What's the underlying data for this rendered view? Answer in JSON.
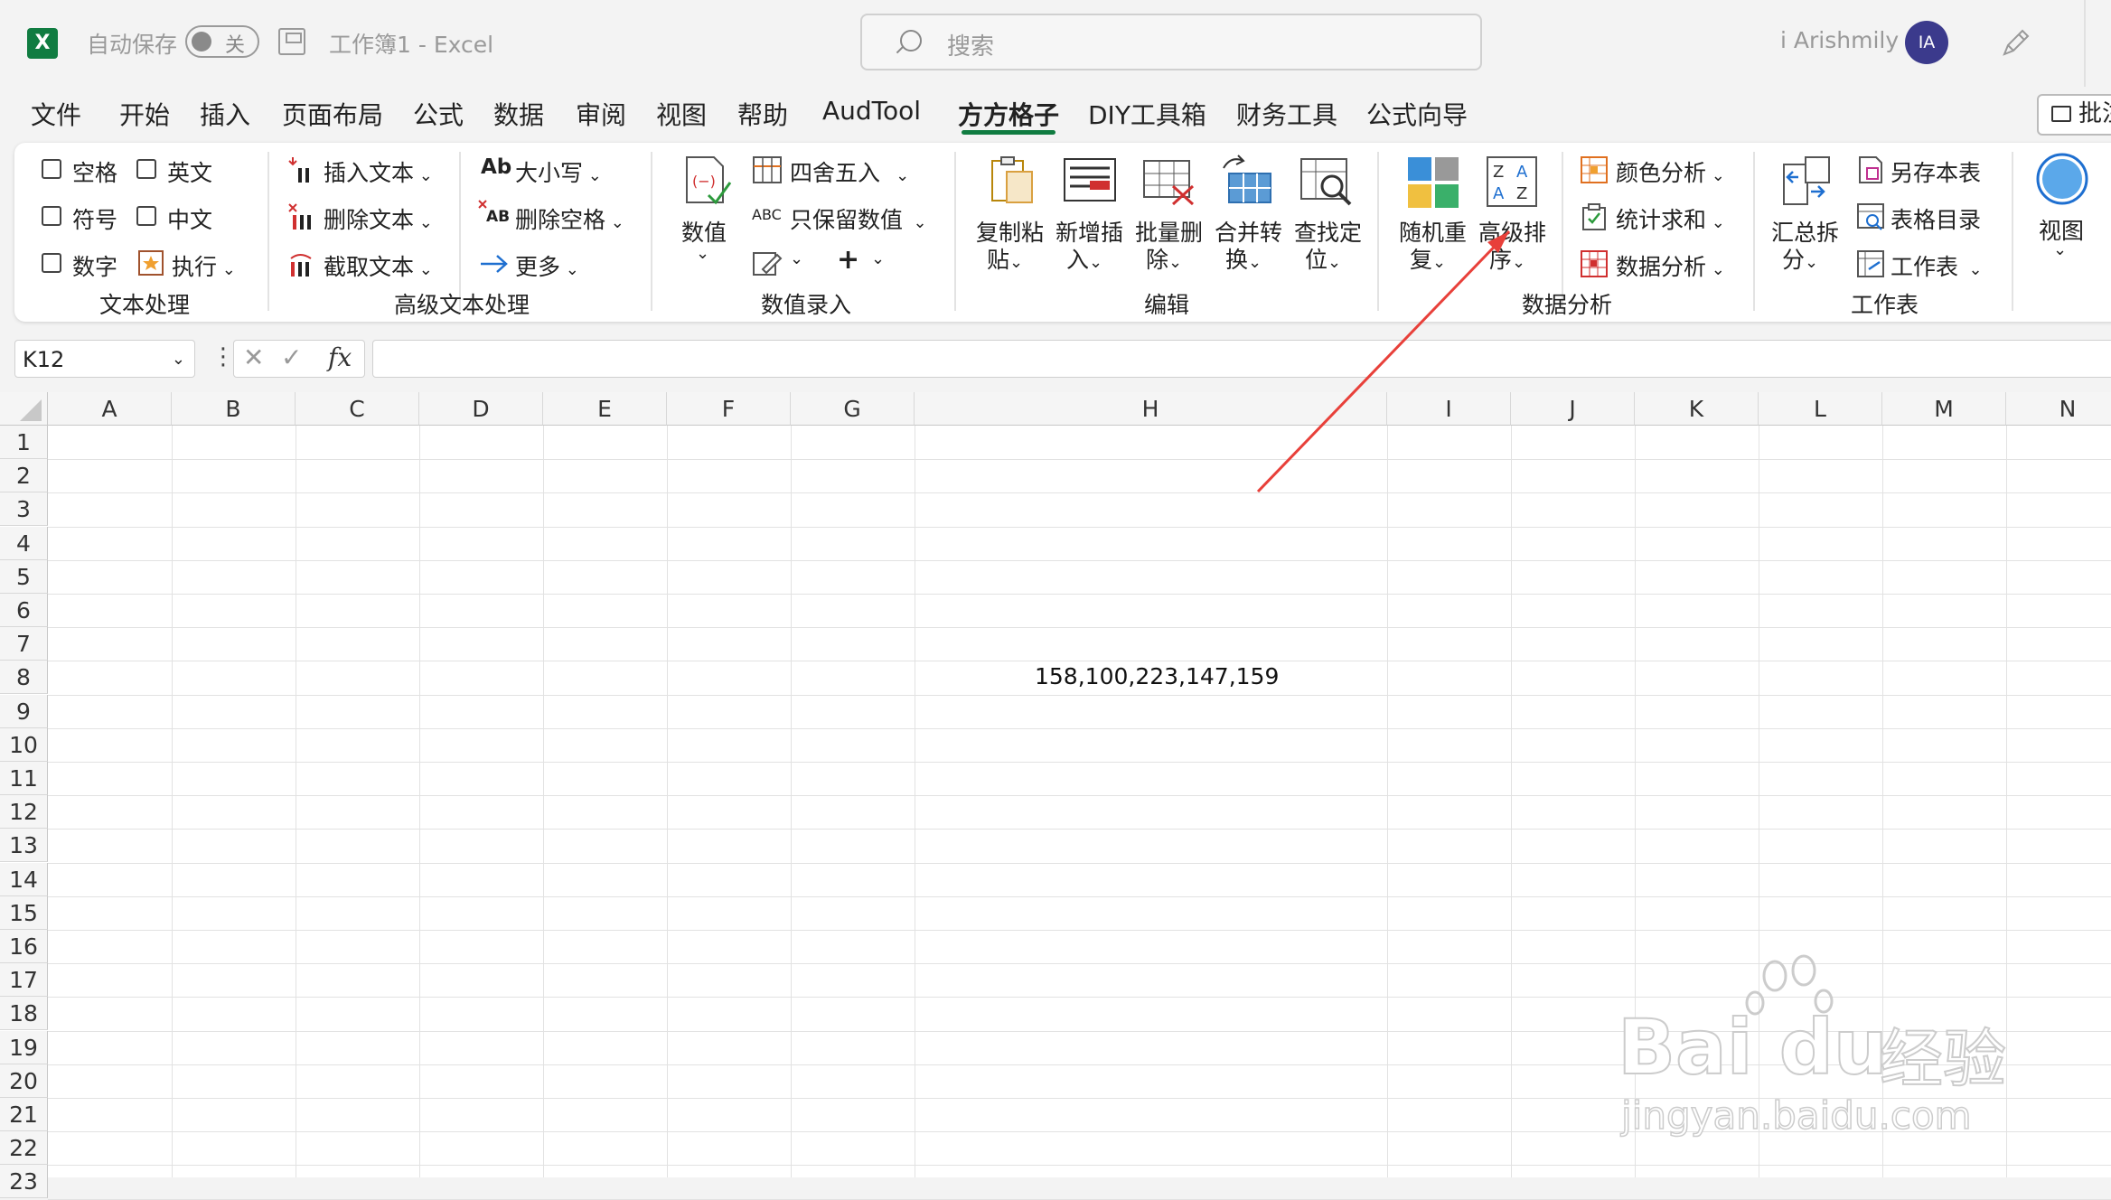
{
  "titlebar": {
    "app_icon": "X",
    "autosave_label": "自动保存",
    "autosave_state": "关",
    "doc_title": "工作簿1  -  Excel",
    "search_placeholder": "搜索",
    "user_name": "i Arishmily",
    "avatar_initials": "IA"
  },
  "menu": {
    "items": [
      "文件",
      "开始",
      "插入",
      "页面布局",
      "公式",
      "数据",
      "审阅",
      "视图",
      "帮助",
      "AudTool",
      "方方格子",
      "DIY工具箱",
      "财务工具",
      "公式向导"
    ],
    "active": "方方格子",
    "comment_button": "批注"
  },
  "ribbon": {
    "text_proc": {
      "items": [
        "空格",
        "英文",
        "符号",
        "中文",
        "数字"
      ],
      "execute": "执行",
      "group_label": "文本处理"
    },
    "adv_text": {
      "insert_text": "插入文本",
      "delete_text": "删除文本",
      "extract_text": "截取文本",
      "case": "大小写",
      "remove_spaces": "删除空格",
      "more": "更多",
      "case_icon": "Ab",
      "spaces_icon": "AB",
      "group_label": "高级文本处理"
    },
    "num_input": {
      "value": "数值",
      "round": "四舍五入",
      "keep_value": "只保留数值",
      "abc": "ABC",
      "group_label": "数值录入"
    },
    "edit": {
      "copy_paste": [
        "复制粘",
        "贴"
      ],
      "insert_new": [
        "新增插",
        "入"
      ],
      "batch_delete": [
        "批量删",
        "除"
      ],
      "merge_convert": [
        "合并转",
        "换"
      ],
      "find_locate": [
        "查找定",
        "位"
      ],
      "group_label": "编辑"
    },
    "analysis": {
      "random_dup": [
        "随机重",
        "复"
      ],
      "adv_sort": [
        "高级排",
        "序"
      ],
      "color_analysis": "颜色分析",
      "sum_stats": "统计求和",
      "data_analysis": "数据分析",
      "group_label": "数据分析"
    },
    "worksheet": {
      "summary_split": [
        "汇总拆",
        "分"
      ],
      "save_sheet": "另存本表",
      "sheet_index": "表格目录",
      "worksheet": "工作表",
      "group_label": "工作表"
    },
    "view": {
      "label": "视图"
    }
  },
  "formula_bar": {
    "name_box": "K12",
    "fx": "fx",
    "formula": ""
  },
  "sheet": {
    "columns": [
      "A",
      "B",
      "C",
      "D",
      "E",
      "F",
      "G",
      "H",
      "I",
      "J",
      "K",
      "L",
      "M",
      "N"
    ],
    "rows": [
      "1",
      "2",
      "3",
      "4",
      "5",
      "6",
      "7",
      "8",
      "9",
      "10",
      "11",
      "12",
      "13",
      "14",
      "15",
      "16",
      "17",
      "18",
      "19",
      "20",
      "21",
      "22",
      "23"
    ],
    "cell_H8": "158,100,223,147,159"
  },
  "watermark": {
    "brand": "Bai  du",
    "brand_cn": "经验",
    "url": "jingyan.baidu.com"
  },
  "colors": {
    "excel_green": "#107c41",
    "annotation_arrow": "#e8403a",
    "avatar_bg": "#3b3a8c"
  }
}
